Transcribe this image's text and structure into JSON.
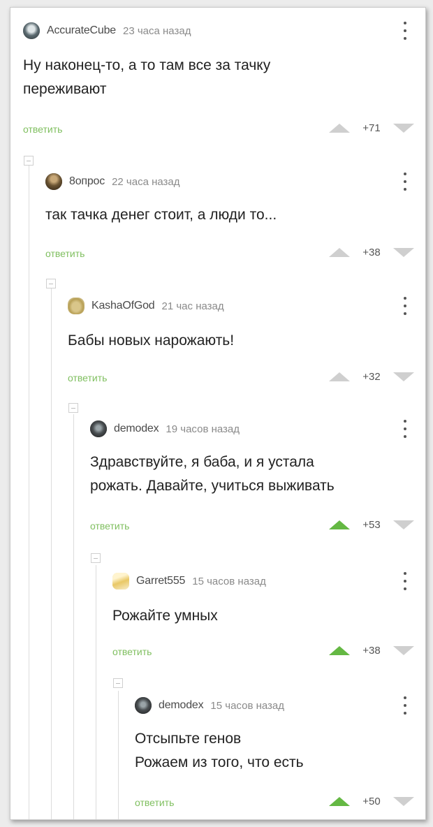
{
  "comments": [
    {
      "username": "AccurateCube",
      "time": "23 часа назад",
      "text": "Ну наконец-то, а то там все за тачку\nпереживают",
      "reply": "ответить",
      "score": "+71",
      "upvoted": false
    },
    {
      "username": "8опрос",
      "time": "22 часа назад",
      "text": "так тачка денег стоит, а люди то...",
      "reply": "ответить",
      "score": "+38",
      "upvoted": false
    },
    {
      "username": "KashaOfGod",
      "time": "21 час назад",
      "text": "Бабы новых нарожають!",
      "reply": "ответить",
      "score": "+32",
      "upvoted": false
    },
    {
      "username": "demodex",
      "time": "19 часов назад",
      "text": "Здравствуйте, я баба, и я устала\nрожать. Давайте, учиться выживать",
      "reply": "ответить",
      "score": "+53",
      "upvoted": true
    },
    {
      "username": "Garret555",
      "time": "15 часов назад",
      "text": "Рожайте умных",
      "reply": "ответить",
      "score": "+38",
      "upvoted": true
    },
    {
      "username": "demodex",
      "time": "15 часов назад",
      "text": "Отсыпьте генов\nРожаем из того, что есть",
      "reply": "ответить",
      "score": "+50",
      "upvoted": true
    }
  ],
  "colors": {
    "reply": "#7fbf5f",
    "upvote_active": "#64b843",
    "vote_idle": "#cfcfcf"
  }
}
